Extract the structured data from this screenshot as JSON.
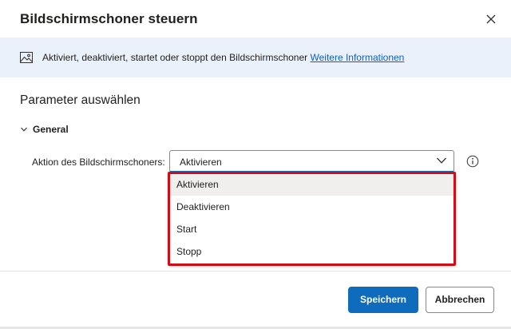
{
  "dialog": {
    "title": "Bildschirmschoner steuern"
  },
  "info": {
    "text": "Aktiviert, deaktiviert, startet oder stoppt den Bildschirmschoner",
    "link_label": "Weitere Informationen"
  },
  "section": {
    "title": "Parameter auswählen"
  },
  "group": {
    "label": "General",
    "expanded": true
  },
  "field": {
    "label": "Aktion des Bildschirmschoners:",
    "selected_value": "Aktivieren",
    "options": [
      "Aktivieren",
      "Deaktivieren",
      "Start",
      "Stopp"
    ]
  },
  "footer": {
    "save_label": "Speichern",
    "cancel_label": "Abbrechen"
  },
  "colors": {
    "accent": "#0f6cbd",
    "info_background": "#eaf1fb",
    "link": "#0f5fc2",
    "highlight_frame": "#d40b14"
  },
  "icons": {
    "close": "close-icon",
    "info": "image-icon",
    "group": "chevron-down-icon",
    "select": "chevron-down-icon",
    "help": "info-icon"
  }
}
